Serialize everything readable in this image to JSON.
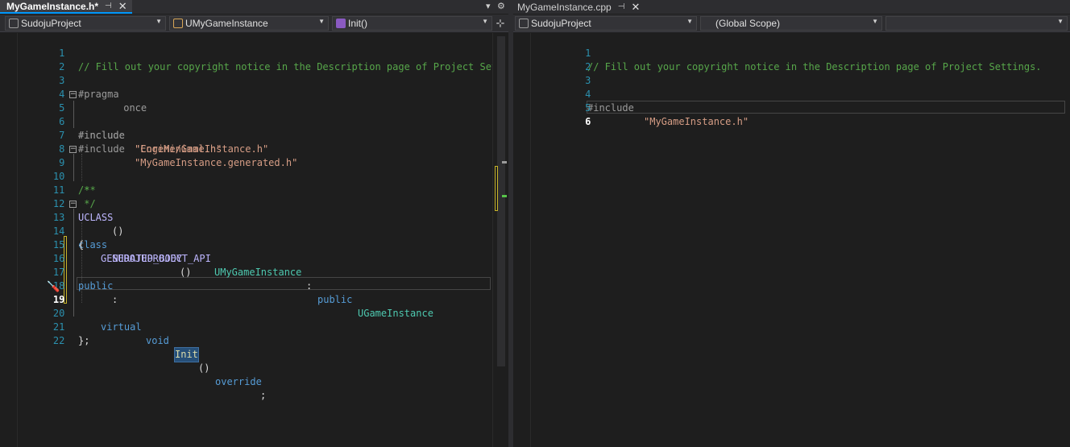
{
  "left": {
    "tab": {
      "title": "MyGameInstance.h*",
      "pin": "⊣",
      "close": "✕"
    },
    "strip_icons": {
      "dropdown": "▾",
      "settings": "⚙"
    },
    "nav": {
      "project": "SudojuProject",
      "class": "UMyGameInstance",
      "member": "Init()",
      "split": "⊹"
    },
    "lines": [
      {
        "n": "1"
      },
      {
        "n": "2"
      },
      {
        "n": "3"
      },
      {
        "n": "4"
      },
      {
        "n": "5"
      },
      {
        "n": "6"
      },
      {
        "n": "7"
      },
      {
        "n": "8"
      },
      {
        "n": "9"
      },
      {
        "n": "10"
      },
      {
        "n": "11"
      },
      {
        "n": "12"
      },
      {
        "n": "13"
      },
      {
        "n": "14"
      },
      {
        "n": "15"
      },
      {
        "n": "16"
      },
      {
        "n": "17"
      },
      {
        "n": "18"
      },
      {
        "n": "19"
      },
      {
        "n": "20"
      },
      {
        "n": "21"
      },
      {
        "n": "22"
      }
    ],
    "code": {
      "l1": "// Fill out your copyright notice in the Description page of Project Setti",
      "l3_a": "#pragma",
      "l3_b": " once",
      "l5_a": "#include",
      "l5_b": "\"CoreMinimal.h\"",
      "l6_a": "#include",
      "l6_b": "\"Engine/GameInstance.h\"",
      "l7_a": "#include",
      "l7_b": "\"MyGameInstance.generated.h\"",
      "l9": "/**",
      "l10": " *",
      "l11": " */",
      "l12_a": "UCLASS",
      "l12_b": "()",
      "l13_a": "class",
      "l13_b": "SUDOJUPROJECT_API",
      "l13_c": "UMyGameInstance",
      "l13_d": ":",
      "l13_e": "public",
      "l13_f": "UGameInstance",
      "l14": "{",
      "l15_a": "GENERATED_BODY",
      "l15_b": "()",
      "l17_a": "public",
      "l17_b": ":",
      "l19_a": "virtual",
      "l19_b": "void",
      "l19_c": "Init",
      "l19_d": "()",
      "l19_e": "override",
      "l19_f": ";",
      "l21": "};"
    }
  },
  "right": {
    "tab": {
      "title": "MyGameInstance.cpp",
      "pin": "⊣",
      "close": "✕"
    },
    "nav": {
      "project": "SudojuProject",
      "scope": "(Global Scope)",
      "member": ""
    },
    "lines": [
      {
        "n": "1"
      },
      {
        "n": "2"
      },
      {
        "n": "3"
      },
      {
        "n": "4"
      },
      {
        "n": "5"
      },
      {
        "n": "6"
      }
    ],
    "code": {
      "l1": "// Fill out your copyright notice in the Description page of Project Settings.",
      "l4_a": "#include",
      "l4_b": "\"MyGameInstance.h\""
    }
  },
  "colors": {
    "comment": "#57a64a",
    "keyword": "#569cd6",
    "string": "#d69d85",
    "type": "#4ec9b0",
    "macro": "#beb7ff",
    "line_number": "#2b91af",
    "change_bar": "#c8b52a",
    "accent": "#0097fb"
  }
}
